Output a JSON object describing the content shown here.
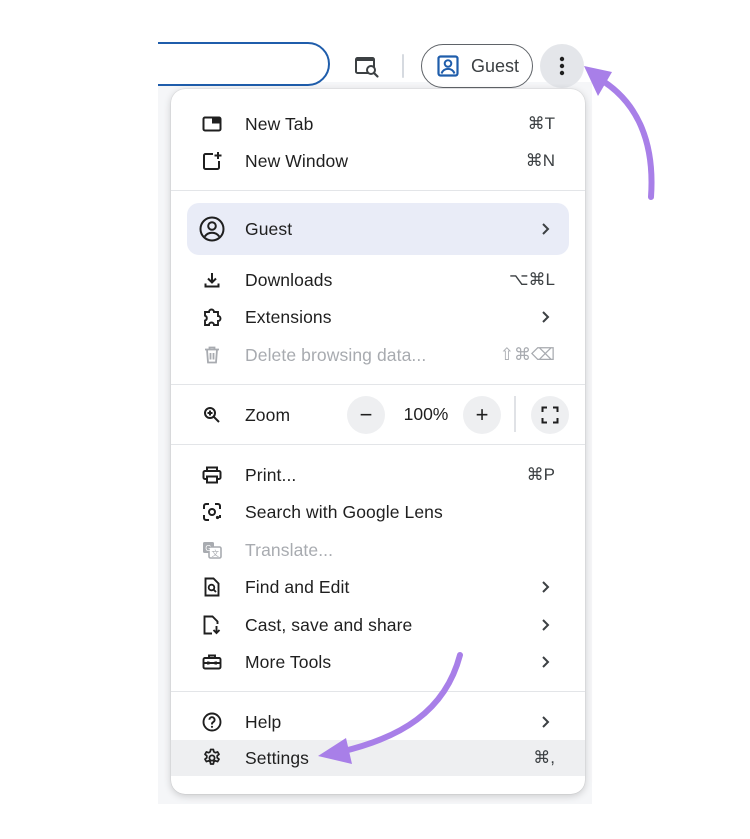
{
  "toolbar": {
    "lens_icon": "lens-search-icon",
    "guest_label": "Guest",
    "menu_icon": "more-vertical-icon"
  },
  "menu": {
    "new_tab": {
      "label": "New Tab",
      "shortcut": "⌘T"
    },
    "new_window": {
      "label": "New Window",
      "shortcut": "⌘N"
    },
    "guest": {
      "label": "Guest"
    },
    "downloads": {
      "label": "Downloads",
      "shortcut": "⌥⌘L"
    },
    "extensions": {
      "label": "Extensions"
    },
    "delete_data": {
      "label": "Delete browsing data...",
      "shortcut": "⇧⌘⌫"
    },
    "zoom": {
      "label": "Zoom",
      "minus": "−",
      "value": "100%",
      "plus": "+"
    },
    "print": {
      "label": "Print...",
      "shortcut": "⌘P"
    },
    "lens": {
      "label": "Search with Google Lens"
    },
    "translate": {
      "label": "Translate..."
    },
    "find_edit": {
      "label": "Find and Edit"
    },
    "cast": {
      "label": "Cast, save and share"
    },
    "more_tools": {
      "label": "More Tools"
    },
    "help": {
      "label": "Help"
    },
    "settings": {
      "label": "Settings",
      "shortcut": "⌘,"
    }
  },
  "colors": {
    "accent_blue": "#1f5dab",
    "annotation_purple": "#a87fe8",
    "guest_highlight": "#e9ecf7",
    "disabled_text": "#a8abb0"
  }
}
